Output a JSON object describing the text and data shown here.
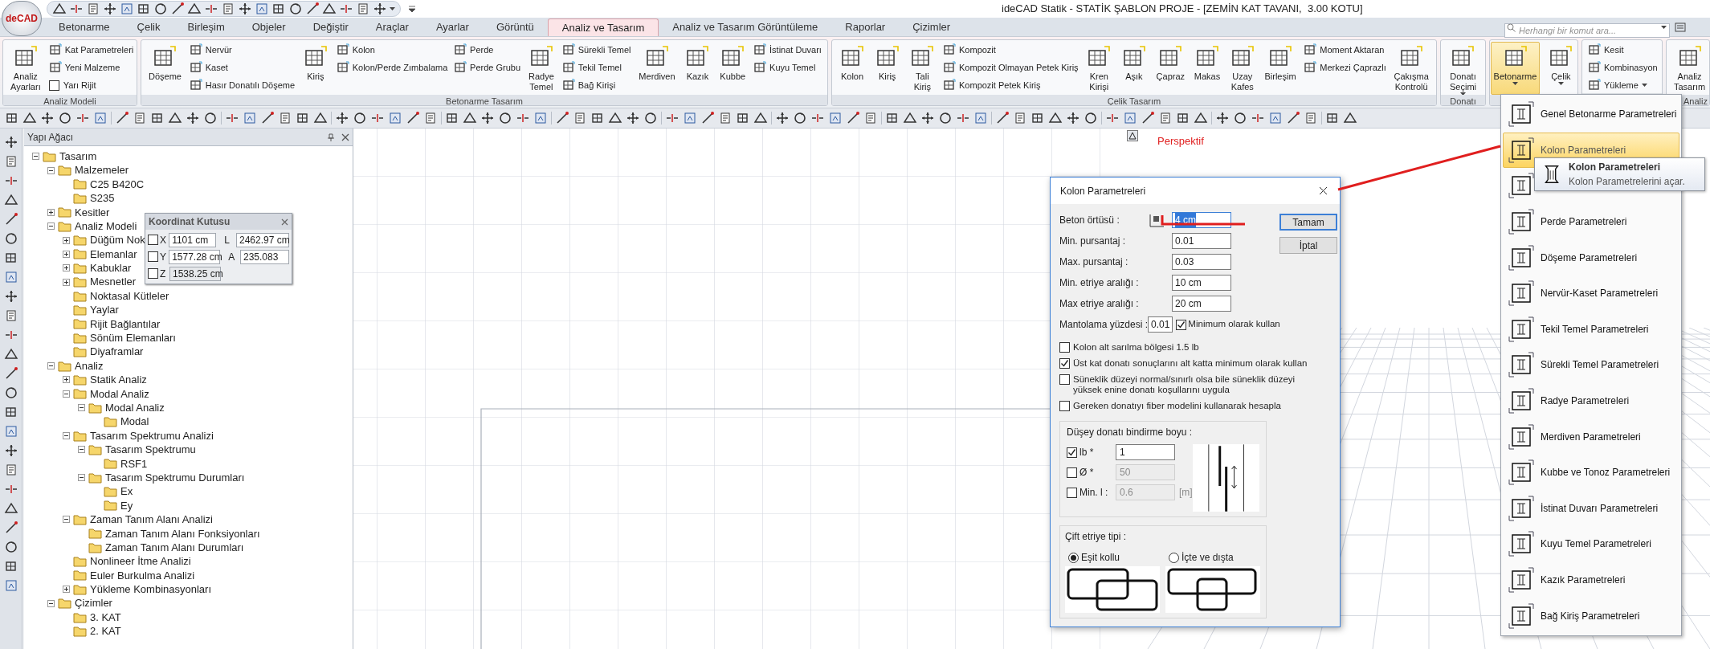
{
  "window": {
    "title": "ideCAD Statik - STATİK ŞABLON PROJE - [ZEMİN KAT TAVANI,  3.00 KOTU]",
    "logo": "deCAD"
  },
  "tabs": [
    {
      "label": "Betonarme",
      "selected": false
    },
    {
      "label": "Çelik",
      "selected": false
    },
    {
      "label": "Birleşim",
      "selected": false
    },
    {
      "label": "Objeler",
      "selected": false
    },
    {
      "label": "Değiştir",
      "selected": false
    },
    {
      "label": "Araçlar",
      "selected": false
    },
    {
      "label": "Ayarlar",
      "selected": false
    },
    {
      "label": "Görüntü",
      "selected": false
    },
    {
      "label": "Analiz ve Tasarım",
      "selected": true
    },
    {
      "label": "Analiz ve Tasarım Görüntüleme",
      "selected": false
    },
    {
      "label": "Raporlar",
      "selected": false
    },
    {
      "label": "Çizimler",
      "selected": false
    }
  ],
  "search": {
    "placeholder": "Herhangi bir komut ara..."
  },
  "ribbon_groups": [
    {
      "label": "Analiz Modeli",
      "controls": [
        {
          "kind": "large",
          "label": "Analiz\nAyarları"
        },
        {
          "kind": "stack",
          "items": [
            {
              "kind": "button",
              "label": "Kat Parametreleri"
            },
            {
              "kind": "button",
              "label": "Yeni Malzeme"
            },
            {
              "kind": "checkbox",
              "label": "Yarı Rijit",
              "checked": false
            }
          ]
        }
      ]
    },
    {
      "label": "Betonarme Tasarım",
      "controls": [
        {
          "kind": "large",
          "label": "Döşeme"
        },
        {
          "kind": "stack",
          "items": [
            {
              "kind": "button",
              "label": "Nervür"
            },
            {
              "kind": "button",
              "label": "Kaset"
            },
            {
              "kind": "button",
              "label": "Hasır Donatılı Döşeme"
            }
          ]
        },
        {
          "kind": "large",
          "label": "Kiriş"
        },
        {
          "kind": "stack",
          "items": [
            {
              "kind": "button",
              "label": "Kolon"
            },
            {
              "kind": "button",
              "label": "Kolon/Perde Zımbalama"
            }
          ]
        },
        {
          "kind": "stack",
          "items": [
            {
              "kind": "button",
              "label": "Perde"
            },
            {
              "kind": "button",
              "label": "Perde Grubu"
            }
          ]
        },
        {
          "kind": "large",
          "label": "Radye\nTemel"
        },
        {
          "kind": "stack",
          "items": [
            {
              "kind": "button",
              "label": "Sürekli Temel"
            },
            {
              "kind": "button",
              "label": "Tekil Temel"
            },
            {
              "kind": "button",
              "label": "Bağ Kirişi"
            }
          ]
        },
        {
          "kind": "large",
          "label": "Merdiven"
        },
        {
          "kind": "large",
          "label": "Kazık"
        },
        {
          "kind": "large",
          "label": "Kubbe"
        },
        {
          "kind": "stack",
          "items": [
            {
              "kind": "button",
              "label": "İstinat Duvarı"
            },
            {
              "kind": "button",
              "label": "Kuyu Temel"
            }
          ]
        }
      ]
    },
    {
      "label": "Çelik Tasarım",
      "controls": [
        {
          "kind": "large",
          "label": "Kolon"
        },
        {
          "kind": "large",
          "label": "Kiriş"
        },
        {
          "kind": "large",
          "label": "Tali\nKiriş"
        },
        {
          "kind": "stack",
          "items": [
            {
              "kind": "button",
              "label": "Kompozit"
            },
            {
              "kind": "button",
              "label": "Kompozit Olmayan Petek Kiriş"
            },
            {
              "kind": "button",
              "label": "Kompozit Petek Kiriş"
            }
          ]
        },
        {
          "kind": "large",
          "label": "Kren\nKirişi"
        },
        {
          "kind": "large",
          "label": "Aşık"
        },
        {
          "kind": "large",
          "label": "Çapraz"
        },
        {
          "kind": "large",
          "label": "Makas"
        },
        {
          "kind": "large",
          "label": "Uzay\nKafes"
        },
        {
          "kind": "large",
          "label": "Birleşim"
        },
        {
          "kind": "stack",
          "items": [
            {
              "kind": "button",
              "label": "Moment Aktaran"
            },
            {
              "kind": "button",
              "label": "Merkezi Çaprazlı"
            }
          ]
        },
        {
          "kind": "large",
          "label": "Çakışma\nKontrolü"
        }
      ]
    },
    {
      "label": "Donatı",
      "controls": [
        {
          "kind": "large",
          "label": "Donatı\nSeçimi",
          "dropdown": true
        }
      ]
    },
    {
      "controls": [
        {
          "kind": "large",
          "label": "Betonarme",
          "dropdown": true,
          "selected": true
        },
        {
          "kind": "large",
          "label": "Çelik",
          "dropdown": true,
          "selected": false
        }
      ]
    },
    {
      "controls": [
        {
          "kind": "stack",
          "items": [
            {
              "kind": "button",
              "label": "Kesit"
            },
            {
              "kind": "button",
              "label": "Kombinasyon"
            },
            {
              "kind": "button",
              "label": "Yükleme",
              "dropdown": true
            }
          ]
        }
      ]
    },
    {
      "label": "Analiz",
      "controls": [
        {
          "kind": "large",
          "label": "Analiz\nTasarım"
        }
      ]
    }
  ],
  "structure_tree": {
    "title": "Yapı Ağacı",
    "nodes": [
      {
        "label": "Tasarım",
        "expanded": true,
        "children": [
          {
            "label": "Malzemeler",
            "expanded": true,
            "children": [
              {
                "label": "C25 B420C"
              },
              {
                "label": "S235"
              }
            ]
          },
          {
            "label": "Kesitler",
            "expanded": false
          },
          {
            "label": "Analiz Modeli",
            "expanded": true,
            "children": [
              {
                "label": "Düğüm Nok",
                "expanded": false
              },
              {
                "label": "Elemanlar",
                "expanded": false
              },
              {
                "label": "Kabuklar",
                "expanded": false
              },
              {
                "label": "Mesnetler",
                "expanded": false
              },
              {
                "label": "Noktasal Kütleler"
              },
              {
                "label": "Yaylar"
              },
              {
                "label": "Rijit Bağlantılar"
              },
              {
                "label": "Sönüm Elemanları"
              },
              {
                "label": "Diyaframlar"
              }
            ]
          },
          {
            "label": "Analiz",
            "expanded": true,
            "children": [
              {
                "label": "Statik Analiz",
                "expanded": false
              },
              {
                "label": "Modal Analiz",
                "expanded": true,
                "children": [
                  {
                    "label": "Modal Analiz",
                    "expanded": true,
                    "children": [
                      {
                        "label": "Modal"
                      }
                    ]
                  }
                ]
              },
              {
                "label": "Tasarım Spektrumu Analizi",
                "expanded": true,
                "children": [
                  {
                    "label": "Tasarım Spektrumu",
                    "expanded": true,
                    "children": [
                      {
                        "label": "RSF1"
                      }
                    ]
                  },
                  {
                    "label": "Tasarım Spektrumu Durumları",
                    "expanded": true,
                    "children": [
                      {
                        "label": "Ex"
                      },
                      {
                        "label": "Ey"
                      }
                    ]
                  }
                ]
              },
              {
                "label": "Zaman Tanım Alanı Analizi",
                "expanded": true,
                "children": [
                  {
                    "label": "Zaman Tanım Alanı Fonksiyonları"
                  },
                  {
                    "label": "Zaman Tanım Alanı Durumları"
                  }
                ]
              },
              {
                "label": "Nonlineer İtme Analizi"
              },
              {
                "label": "Euler Burkulma Analizi"
              },
              {
                "label": "Yükleme Kombinasyonları",
                "expanded": false
              }
            ]
          },
          {
            "label": "Çizimler",
            "expanded": true,
            "children": [
              {
                "label": "3. KAT"
              },
              {
                "label": "2. KAT"
              }
            ]
          }
        ]
      }
    ]
  },
  "coordinate_box": {
    "title": "Koordinat Kutusu",
    "rows": [
      {
        "axis": "X",
        "checked": false,
        "value": "1101 cm",
        "disabled": false,
        "label_2": "L",
        "value_2": "2462.97 cm"
      },
      {
        "axis": "Y",
        "checked": false,
        "value": "1577.28 cm",
        "disabled": false,
        "label_2": "A",
        "value_2": "235.083"
      },
      {
        "axis": "Z",
        "checked": false,
        "value": "1538.25 cm",
        "disabled": true
      }
    ]
  },
  "view_label": "Perspektif",
  "dialog": {
    "title": "Kolon Parametreleri",
    "fields": [
      {
        "label": "Beton örtüsü :",
        "value": "4 cm",
        "highlighted": true
      },
      {
        "label": "Min.  pursantaj :",
        "value": "0.01",
        "highlighted": false
      },
      {
        "label": "Max. pursantaj :",
        "value": "0.03",
        "highlighted": false
      },
      {
        "label": "Min. etriye aralığı :",
        "value": "10 cm",
        "highlighted": false
      },
      {
        "label": "Max etriye aralığı :",
        "value": "20 cm",
        "highlighted": false
      },
      {
        "label": "Mantolama yüzdesi :",
        "value": "0.01",
        "highlighted": false,
        "option": {
          "label": "Minimum olarak kullan",
          "checked": true
        }
      }
    ],
    "buttons": [
      {
        "label": "Tamam",
        "default": true
      },
      {
        "label": "İptal",
        "default": false
      }
    ],
    "checkboxes": [
      {
        "label": "Kolon alt sarılma bölgesi 1.5 lb",
        "checked": false
      },
      {
        "label": "Üst kat donatı sonuçlarını alt katta minimum olarak kullan",
        "checked": true
      },
      {
        "label": "Süneklik düzeyi normal/sınırlı olsa bile süneklik düzeyi yüksek enine donatı koşullarını uygula",
        "checked": false
      },
      {
        "label": "Gereken donatıyı fiber modelini kullanarak hesapla",
        "checked": false
      }
    ],
    "lap_length": {
      "title": "Düşey donatı bindirme boyu :",
      "rows": [
        {
          "label": "lb *",
          "checked": true,
          "value": "1",
          "disabled": false
        },
        {
          "label": "Ø *",
          "checked": false,
          "value": "50",
          "disabled": true
        },
        {
          "label": "Min. l :",
          "checked": false,
          "value": "0.6",
          "disabled": true,
          "unit": "[m]"
        }
      ]
    },
    "stirrup_type": {
      "title": "Çift etriye tipi :",
      "options": [
        {
          "label": "Eşit kollu",
          "selected": true
        },
        {
          "label": "İçte ve dışta",
          "selected": false
        }
      ]
    }
  },
  "dropdown_menu": {
    "items": [
      {
        "label": "Genel Betonarme Parametreleri",
        "selected": false
      },
      {
        "label": "Kolon Parametreleri",
        "selected": true
      },
      {
        "selected": false
      },
      {
        "label": "Perde Parametreleri",
        "selected": false
      },
      {
        "label": "Döşeme Parametreleri",
        "selected": false
      },
      {
        "label": "Nervür-Kaset Parametreleri",
        "selected": false
      },
      {
        "label": "Tekil Temel Parametreleri",
        "selected": false
      },
      {
        "label": "Sürekli Temel Parametreleri",
        "selected": false
      },
      {
        "label": "Radye Parametreleri",
        "selected": false
      },
      {
        "label": "Merdiven Parametreleri",
        "selected": false
      },
      {
        "label": "Kubbe ve Tonoz Parametreleri",
        "selected": false
      },
      {
        "label": "İstinat Duvarı Parametreleri",
        "selected": false
      },
      {
        "label": "Kuyu Temel Parametreleri",
        "selected": false
      },
      {
        "label": "Kazık Parametreleri",
        "selected": false
      },
      {
        "label": "Bağ Kiriş Parametreleri",
        "selected": false
      }
    ]
  },
  "tooltip": {
    "title": "Kolon Parametreleri",
    "description": "Kolon Parametrelerini açar."
  }
}
